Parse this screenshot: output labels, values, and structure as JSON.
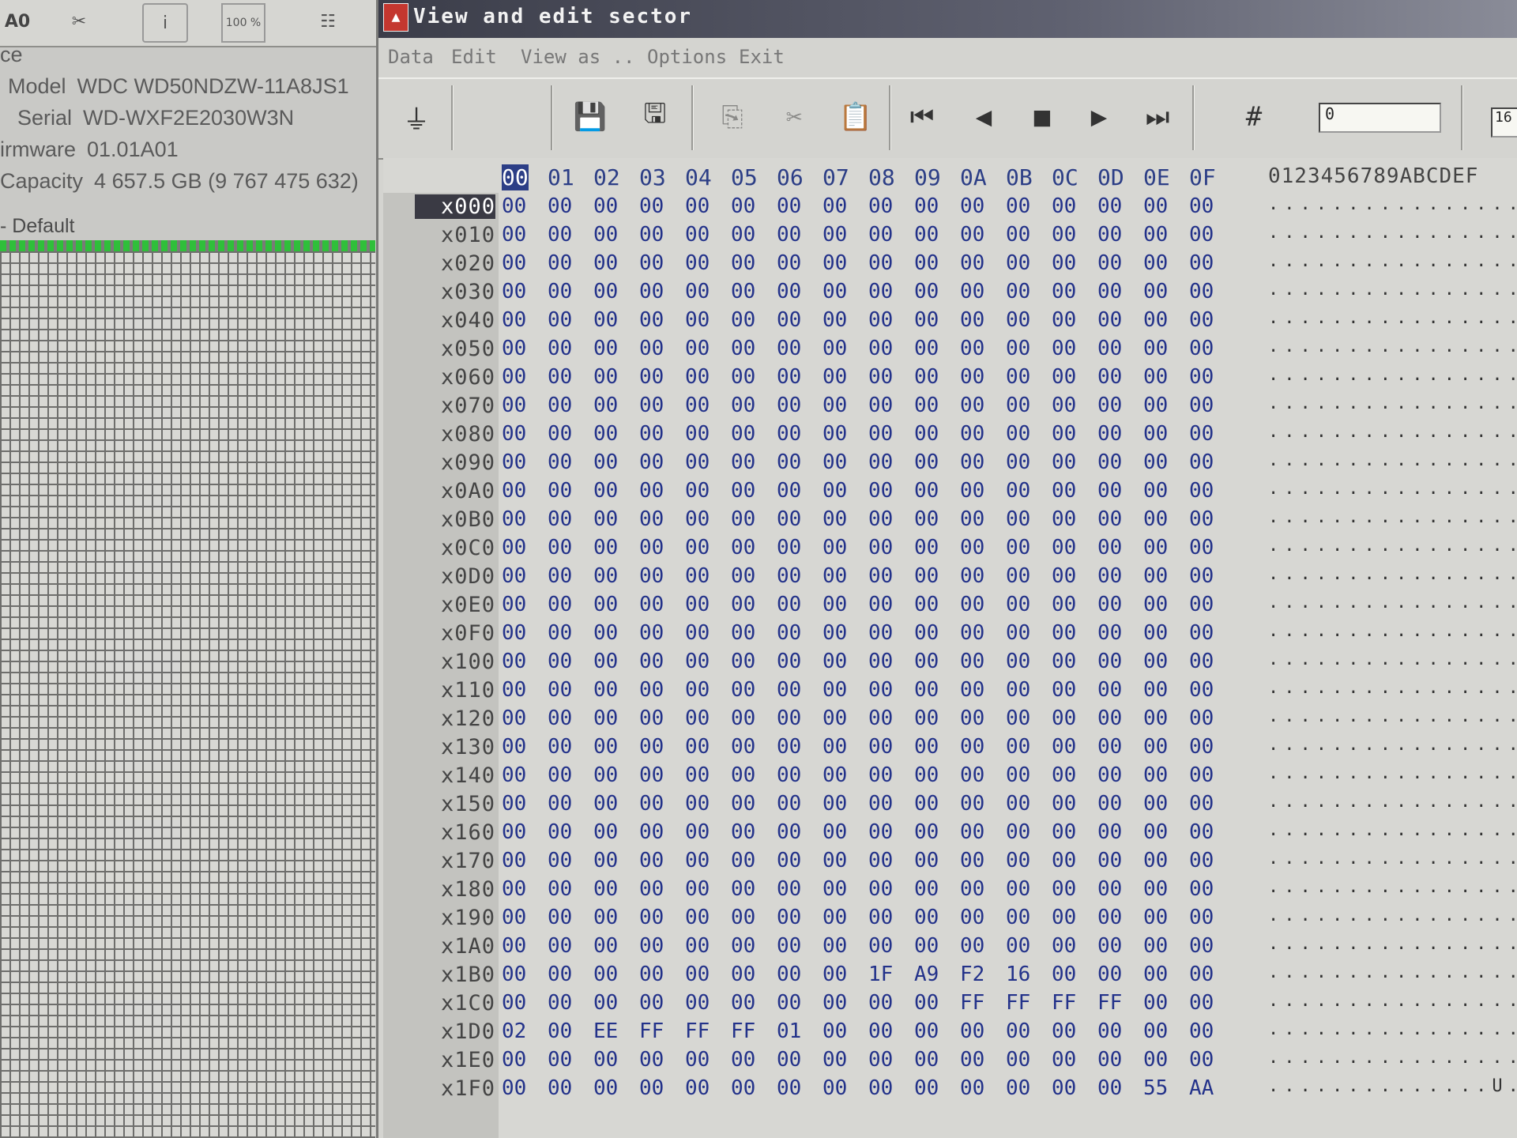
{
  "left_toolbar": {
    "items": [
      {
        "name": "ao-label",
        "label": "A0"
      },
      {
        "name": "tools-icon",
        "label": "✂"
      },
      {
        "name": "info-icon",
        "label": "i"
      },
      {
        "name": "percent-icon",
        "label": "100 %"
      },
      {
        "name": "tree-icon",
        "label": "☷"
      }
    ]
  },
  "drive_info": {
    "section_label": "ce",
    "model_label": "Model",
    "model": "WDC WD50NDZW-11A8JS1",
    "serial_label": "Serial",
    "serial": "WD-WXF2E2030W3N",
    "firmware_label": "irmware",
    "firmware": "01.01A01",
    "capacity_label": "Capacity",
    "capacity": "4 657.5 GB (9 767 475 632)"
  },
  "default_label": "- Default",
  "window": {
    "title": "View and edit sector",
    "menu": [
      "Data",
      "Edit",
      "View as ..",
      "Options",
      "Exit"
    ]
  },
  "toolbar": {
    "offset_value": "0",
    "width_value": "16",
    "buttons": [
      {
        "name": "connect-icon",
        "glyph": "⏚"
      },
      {
        "name": "save-sector-icon",
        "glyph": "💾"
      },
      {
        "name": "save-to-file-icon",
        "glyph": "🖫"
      },
      {
        "name": "copy-icon",
        "glyph": "⎘"
      },
      {
        "name": "cut-icon",
        "glyph": "✂"
      },
      {
        "name": "paste-icon",
        "glyph": "📋"
      },
      {
        "name": "first-sector-icon",
        "glyph": "⏮"
      },
      {
        "name": "previous-sector-icon",
        "glyph": "◀"
      },
      {
        "name": "stop-icon",
        "glyph": "■"
      },
      {
        "name": "next-sector-icon",
        "glyph": "▶"
      },
      {
        "name": "last-sector-icon",
        "glyph": "⏭"
      },
      {
        "name": "goto-sector-icon",
        "glyph": "#"
      }
    ]
  },
  "hex": {
    "column_headers": [
      "00",
      "01",
      "02",
      "03",
      "04",
      "05",
      "06",
      "07",
      "08",
      "09",
      "0A",
      "0B",
      "0C",
      "0D",
      "0E",
      "0F"
    ],
    "ascii_header": "0123456789ABCDEF",
    "rows": [
      {
        "offset": "x000",
        "bytes": [
          "00",
          "00",
          "00",
          "00",
          "00",
          "00",
          "00",
          "00",
          "00",
          "00",
          "00",
          "00",
          "00",
          "00",
          "00",
          "00"
        ],
        "ascii": "................"
      },
      {
        "offset": "x010",
        "bytes": [
          "00",
          "00",
          "00",
          "00",
          "00",
          "00",
          "00",
          "00",
          "00",
          "00",
          "00",
          "00",
          "00",
          "00",
          "00",
          "00"
        ],
        "ascii": "................"
      },
      {
        "offset": "x020",
        "bytes": [
          "00",
          "00",
          "00",
          "00",
          "00",
          "00",
          "00",
          "00",
          "00",
          "00",
          "00",
          "00",
          "00",
          "00",
          "00",
          "00"
        ],
        "ascii": "................"
      },
      {
        "offset": "x030",
        "bytes": [
          "00",
          "00",
          "00",
          "00",
          "00",
          "00",
          "00",
          "00",
          "00",
          "00",
          "00",
          "00",
          "00",
          "00",
          "00",
          "00"
        ],
        "ascii": "................"
      },
      {
        "offset": "x040",
        "bytes": [
          "00",
          "00",
          "00",
          "00",
          "00",
          "00",
          "00",
          "00",
          "00",
          "00",
          "00",
          "00",
          "00",
          "00",
          "00",
          "00"
        ],
        "ascii": "................"
      },
      {
        "offset": "x050",
        "bytes": [
          "00",
          "00",
          "00",
          "00",
          "00",
          "00",
          "00",
          "00",
          "00",
          "00",
          "00",
          "00",
          "00",
          "00",
          "00",
          "00"
        ],
        "ascii": "................"
      },
      {
        "offset": "x060",
        "bytes": [
          "00",
          "00",
          "00",
          "00",
          "00",
          "00",
          "00",
          "00",
          "00",
          "00",
          "00",
          "00",
          "00",
          "00",
          "00",
          "00"
        ],
        "ascii": "................"
      },
      {
        "offset": "x070",
        "bytes": [
          "00",
          "00",
          "00",
          "00",
          "00",
          "00",
          "00",
          "00",
          "00",
          "00",
          "00",
          "00",
          "00",
          "00",
          "00",
          "00"
        ],
        "ascii": "................"
      },
      {
        "offset": "x080",
        "bytes": [
          "00",
          "00",
          "00",
          "00",
          "00",
          "00",
          "00",
          "00",
          "00",
          "00",
          "00",
          "00",
          "00",
          "00",
          "00",
          "00"
        ],
        "ascii": "................"
      },
      {
        "offset": "x090",
        "bytes": [
          "00",
          "00",
          "00",
          "00",
          "00",
          "00",
          "00",
          "00",
          "00",
          "00",
          "00",
          "00",
          "00",
          "00",
          "00",
          "00"
        ],
        "ascii": "................"
      },
      {
        "offset": "x0A0",
        "bytes": [
          "00",
          "00",
          "00",
          "00",
          "00",
          "00",
          "00",
          "00",
          "00",
          "00",
          "00",
          "00",
          "00",
          "00",
          "00",
          "00"
        ],
        "ascii": "................"
      },
      {
        "offset": "x0B0",
        "bytes": [
          "00",
          "00",
          "00",
          "00",
          "00",
          "00",
          "00",
          "00",
          "00",
          "00",
          "00",
          "00",
          "00",
          "00",
          "00",
          "00"
        ],
        "ascii": "................"
      },
      {
        "offset": "x0C0",
        "bytes": [
          "00",
          "00",
          "00",
          "00",
          "00",
          "00",
          "00",
          "00",
          "00",
          "00",
          "00",
          "00",
          "00",
          "00",
          "00",
          "00"
        ],
        "ascii": "................"
      },
      {
        "offset": "x0D0",
        "bytes": [
          "00",
          "00",
          "00",
          "00",
          "00",
          "00",
          "00",
          "00",
          "00",
          "00",
          "00",
          "00",
          "00",
          "00",
          "00",
          "00"
        ],
        "ascii": "................"
      },
      {
        "offset": "x0E0",
        "bytes": [
          "00",
          "00",
          "00",
          "00",
          "00",
          "00",
          "00",
          "00",
          "00",
          "00",
          "00",
          "00",
          "00",
          "00",
          "00",
          "00"
        ],
        "ascii": "................"
      },
      {
        "offset": "x0F0",
        "bytes": [
          "00",
          "00",
          "00",
          "00",
          "00",
          "00",
          "00",
          "00",
          "00",
          "00",
          "00",
          "00",
          "00",
          "00",
          "00",
          "00"
        ],
        "ascii": "................"
      },
      {
        "offset": "x100",
        "bytes": [
          "00",
          "00",
          "00",
          "00",
          "00",
          "00",
          "00",
          "00",
          "00",
          "00",
          "00",
          "00",
          "00",
          "00",
          "00",
          "00"
        ],
        "ascii": "................"
      },
      {
        "offset": "x110",
        "bytes": [
          "00",
          "00",
          "00",
          "00",
          "00",
          "00",
          "00",
          "00",
          "00",
          "00",
          "00",
          "00",
          "00",
          "00",
          "00",
          "00"
        ],
        "ascii": "................"
      },
      {
        "offset": "x120",
        "bytes": [
          "00",
          "00",
          "00",
          "00",
          "00",
          "00",
          "00",
          "00",
          "00",
          "00",
          "00",
          "00",
          "00",
          "00",
          "00",
          "00"
        ],
        "ascii": "................"
      },
      {
        "offset": "x130",
        "bytes": [
          "00",
          "00",
          "00",
          "00",
          "00",
          "00",
          "00",
          "00",
          "00",
          "00",
          "00",
          "00",
          "00",
          "00",
          "00",
          "00"
        ],
        "ascii": "................"
      },
      {
        "offset": "x140",
        "bytes": [
          "00",
          "00",
          "00",
          "00",
          "00",
          "00",
          "00",
          "00",
          "00",
          "00",
          "00",
          "00",
          "00",
          "00",
          "00",
          "00"
        ],
        "ascii": "................"
      },
      {
        "offset": "x150",
        "bytes": [
          "00",
          "00",
          "00",
          "00",
          "00",
          "00",
          "00",
          "00",
          "00",
          "00",
          "00",
          "00",
          "00",
          "00",
          "00",
          "00"
        ],
        "ascii": "................"
      },
      {
        "offset": "x160",
        "bytes": [
          "00",
          "00",
          "00",
          "00",
          "00",
          "00",
          "00",
          "00",
          "00",
          "00",
          "00",
          "00",
          "00",
          "00",
          "00",
          "00"
        ],
        "ascii": "................"
      },
      {
        "offset": "x170",
        "bytes": [
          "00",
          "00",
          "00",
          "00",
          "00",
          "00",
          "00",
          "00",
          "00",
          "00",
          "00",
          "00",
          "00",
          "00",
          "00",
          "00"
        ],
        "ascii": "................"
      },
      {
        "offset": "x180",
        "bytes": [
          "00",
          "00",
          "00",
          "00",
          "00",
          "00",
          "00",
          "00",
          "00",
          "00",
          "00",
          "00",
          "00",
          "00",
          "00",
          "00"
        ],
        "ascii": "................"
      },
      {
        "offset": "x190",
        "bytes": [
          "00",
          "00",
          "00",
          "00",
          "00",
          "00",
          "00",
          "00",
          "00",
          "00",
          "00",
          "00",
          "00",
          "00",
          "00",
          "00"
        ],
        "ascii": "................"
      },
      {
        "offset": "x1A0",
        "bytes": [
          "00",
          "00",
          "00",
          "00",
          "00",
          "00",
          "00",
          "00",
          "00",
          "00",
          "00",
          "00",
          "00",
          "00",
          "00",
          "00"
        ],
        "ascii": "................"
      },
      {
        "offset": "x1B0",
        "bytes": [
          "00",
          "00",
          "00",
          "00",
          "00",
          "00",
          "00",
          "00",
          "1F",
          "A9",
          "F2",
          "16",
          "00",
          "00",
          "00",
          "00"
        ],
        "ascii": "................"
      },
      {
        "offset": "x1C0",
        "bytes": [
          "00",
          "00",
          "00",
          "00",
          "00",
          "00",
          "00",
          "00",
          "00",
          "00",
          "FF",
          "FF",
          "FF",
          "FF",
          "00",
          "00"
        ],
        "ascii": "................"
      },
      {
        "offset": "x1D0",
        "bytes": [
          "02",
          "00",
          "EE",
          "FF",
          "FF",
          "FF",
          "01",
          "00",
          "00",
          "00",
          "00",
          "00",
          "00",
          "00",
          "00",
          "00"
        ],
        "ascii": "................"
      },
      {
        "offset": "x1E0",
        "bytes": [
          "00",
          "00",
          "00",
          "00",
          "00",
          "00",
          "00",
          "00",
          "00",
          "00",
          "00",
          "00",
          "00",
          "00",
          "00",
          "00"
        ],
        "ascii": "................"
      },
      {
        "offset": "x1F0",
        "bytes": [
          "00",
          "00",
          "00",
          "00",
          "00",
          "00",
          "00",
          "00",
          "00",
          "00",
          "00",
          "00",
          "00",
          "00",
          "55",
          "AA"
        ],
        "ascii": "..............U."
      }
    ]
  },
  "colors": {
    "hex_text": "#23328a",
    "selection": "#2c3e86",
    "window_bg": "#d4d4d0",
    "title_bar": "#3b3d49",
    "sector_ok": "#2fbf3a"
  }
}
